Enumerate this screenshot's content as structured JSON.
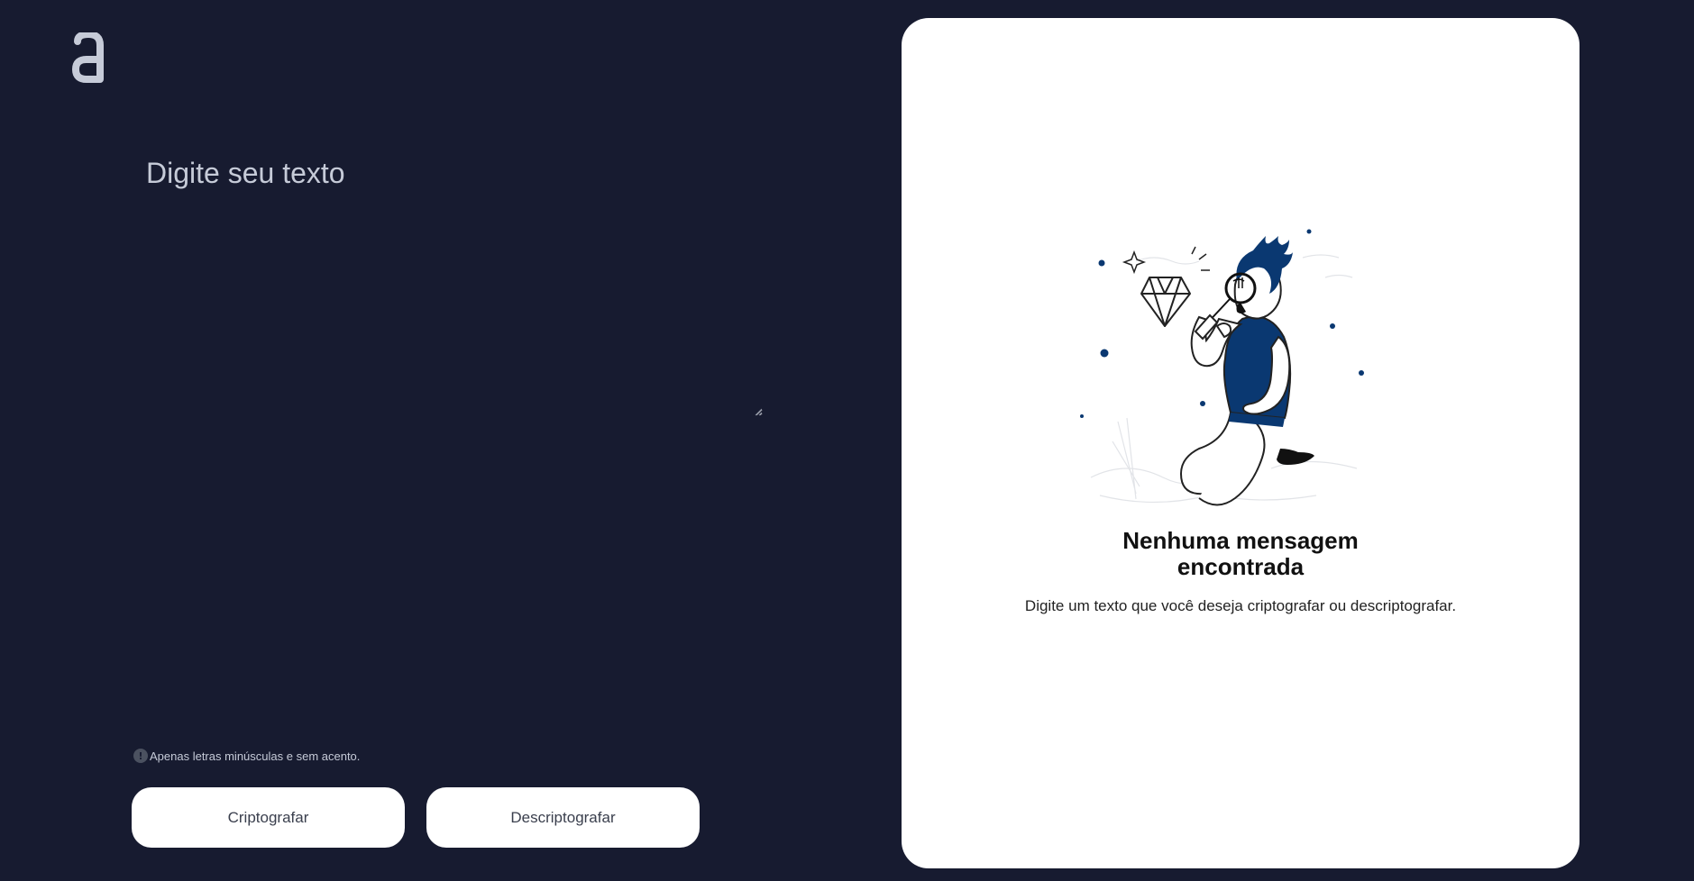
{
  "logo": {
    "icon": "alura-logo",
    "glyph": "a"
  },
  "input": {
    "placeholder": "Digite seu texto",
    "value": ""
  },
  "hint": {
    "icon": "info-icon",
    "text": "Apenas letras minúsculas e sem acento."
  },
  "buttons": {
    "encrypt_label": "Criptografar",
    "decrypt_label": "Descriptografar"
  },
  "output": {
    "title_line1": "Nenhuma mensagem",
    "title_line2": "encontrada",
    "description": "Digite um texto que você deseja criptografar ou descriptografar.",
    "illustration": "person-searching-diamond"
  },
  "colors": {
    "background": "#171b30",
    "panel": "#ffffff",
    "accent_blue": "#0a3871",
    "text_light": "#c6cbd8"
  }
}
